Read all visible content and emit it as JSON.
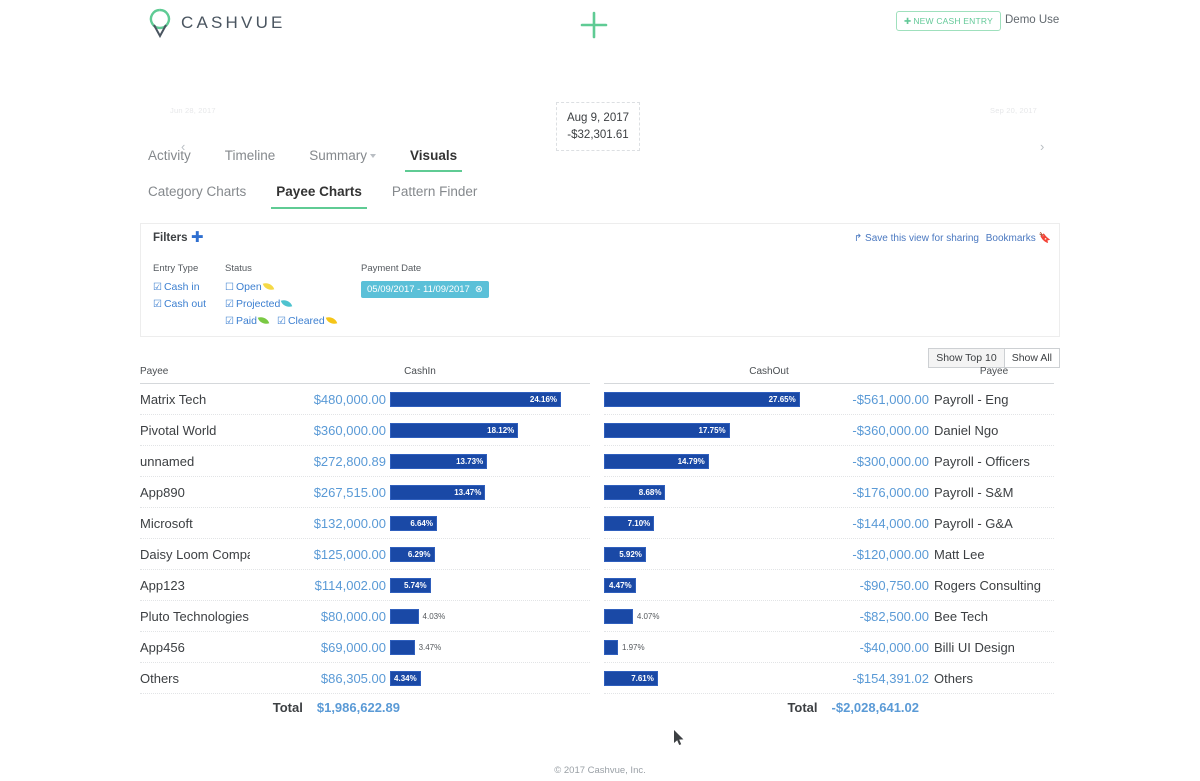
{
  "header": {
    "logo_icon": "cashvue-pin-logo",
    "brand": "CASHVUE",
    "add_icon": "plus-icon",
    "new_entry_label": "NEW CASH ENTRY",
    "new_entry_icon": "plus-icon",
    "user_label": "Demo Use"
  },
  "timeline": {
    "prev_icon": "chevron-left-icon",
    "next_icon": "chevron-right-icon",
    "start_date": "Jun 28, 2017",
    "end_date": "Sep 20, 2017",
    "tooltip_date": "Aug 9, 2017",
    "tooltip_amount": "-$32,301.61"
  },
  "tabs_main": [
    {
      "label": "Activity",
      "active": false
    },
    {
      "label": "Timeline",
      "active": false
    },
    {
      "label": "Summary",
      "active": false,
      "has_caret": true
    },
    {
      "label": "Visuals",
      "active": true
    }
  ],
  "tabs_sub": [
    {
      "label": "Category Charts",
      "active": false
    },
    {
      "label": "Payee Charts",
      "active": true
    },
    {
      "label": "Pattern Finder",
      "active": false
    }
  ],
  "filters": {
    "title": "Filters",
    "add_icon": "plus-icon",
    "save_view_label": "Save this view for sharing",
    "save_view_icon": "share-arrow-icon",
    "bookmarks_label": "Bookmarks",
    "bookmarks_icon": "bookmark-icon",
    "entry_type": {
      "label": "Entry Type",
      "options": [
        {
          "label": "Cash in",
          "checked": true
        },
        {
          "label": "Cash out",
          "checked": true
        }
      ]
    },
    "status": {
      "label": "Status",
      "options": [
        {
          "label": "Open",
          "checked": false,
          "leaf_color": "#f5d946"
        },
        {
          "label": "Projected",
          "checked": true,
          "leaf_color": "#4ec3cf"
        },
        {
          "label": "Paid",
          "checked": true,
          "leaf_color": "#7ac943"
        },
        {
          "label": "Cleared",
          "checked": true,
          "leaf_color": "#f5c518"
        }
      ]
    },
    "payment_date": {
      "label": "Payment Date",
      "value": "05/09/2017 - 11/09/2017",
      "clear_icon": "circle-x-icon"
    }
  },
  "view_toggle": {
    "top_label": "Show Top 10",
    "all_label": "Show All"
  },
  "chart_data": [
    {
      "type": "bar",
      "title": "CashIn",
      "name_header": "Payee",
      "direction": "ltr",
      "categories": [
        "Matrix Tech",
        "Pivotal World",
        "unnamed",
        "App890",
        "Microsoft",
        "Daisy Loom Company",
        "App123",
        "Pluto Technologies",
        "App456",
        "Others"
      ],
      "values": [
        480000.0,
        360000.0,
        272800.89,
        267515.0,
        132000.0,
        125000.0,
        114002.0,
        80000.0,
        69000.0,
        86305.0
      ],
      "amount_labels": [
        "$480,000.00",
        "$360,000.00",
        "$272,800.89",
        "$267,515.00",
        "$132,000.00",
        "$125,000.00",
        "$114,002.00",
        "$80,000.00",
        "$69,000.00",
        "$86,305.00"
      ],
      "percents": [
        24.16,
        18.12,
        13.73,
        13.47,
        6.64,
        6.29,
        5.74,
        4.03,
        3.47,
        4.34
      ],
      "percent_labels": [
        "24.16%",
        "18.12%",
        "13.73%",
        "13.47%",
        "6.64%",
        "6.29%",
        "5.74%",
        "4.03%",
        "3.47%",
        "4.34%"
      ],
      "label_inside": [
        true,
        true,
        true,
        true,
        true,
        true,
        true,
        false,
        false,
        true
      ],
      "total_label": "Total",
      "total_value": "$1,986,622.89",
      "bar_color": "#1a49a6"
    },
    {
      "type": "bar",
      "title": "CashOut",
      "name_header": "Payee",
      "direction": "ltr",
      "categories": [
        "Payroll - Eng",
        "Daniel Ngo",
        "Payroll - Officers",
        "Payroll - S&M",
        "Payroll - G&A",
        "Matt Lee",
        "Rogers Consulting",
        "Bee Tech",
        "Billi UI Design",
        "Others"
      ],
      "values": [
        -561000.0,
        -360000.0,
        -300000.0,
        -176000.0,
        -144000.0,
        -120000.0,
        -90750.0,
        -82500.0,
        -40000.0,
        -154391.02
      ],
      "amount_labels": [
        "-$561,000.00",
        "-$360,000.00",
        "-$300,000.00",
        "-$176,000.00",
        "-$144,000.00",
        "-$120,000.00",
        "-$90,750.00",
        "-$82,500.00",
        "-$40,000.00",
        "-$154,391.02"
      ],
      "percents": [
        27.65,
        17.75,
        14.79,
        8.68,
        7.1,
        5.92,
        4.47,
        4.07,
        1.97,
        7.61
      ],
      "percent_labels": [
        "27.65%",
        "17.75%",
        "14.79%",
        "8.68%",
        "7.10%",
        "5.92%",
        "4.47%",
        "4.07%",
        "1.97%",
        "7.61%"
      ],
      "label_inside": [
        true,
        true,
        true,
        true,
        true,
        true,
        true,
        false,
        false,
        true
      ],
      "total_label": "Total",
      "total_value": "-$2,028,641.02",
      "bar_color": "#1a49a6"
    }
  ],
  "footer": {
    "text": "© 2017 Cashvue, Inc."
  }
}
